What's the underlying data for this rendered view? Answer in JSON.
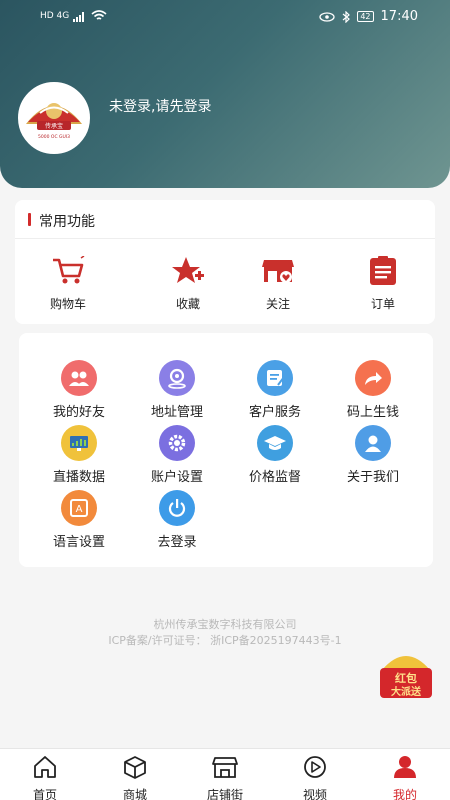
{
  "status_bar": {
    "network": "HD 4G",
    "battery": "42",
    "time": "17:40"
  },
  "header": {
    "login_prompt": "未登录,请先登录",
    "logo_text": "传承宝",
    "logo_subtext": "5000 OC GUI3"
  },
  "common_functions": {
    "title": "常用功能",
    "items": [
      {
        "label": "购物车",
        "icon": "shopping-cart-icon"
      },
      {
        "label": "收藏",
        "icon": "star-plus-icon"
      },
      {
        "label": "关注",
        "icon": "shop-heart-icon"
      },
      {
        "label": "订单",
        "icon": "order-list-icon"
      }
    ]
  },
  "services": {
    "items": [
      {
        "label": "我的好友",
        "icon": "friends-icon",
        "color": "#f06c6c"
      },
      {
        "label": "地址管理",
        "icon": "location-icon",
        "color": "#8a7fe6"
      },
      {
        "label": "客户服务",
        "icon": "service-icon",
        "color": "#4aa0e6"
      },
      {
        "label": "码上生钱",
        "icon": "share-icon",
        "color": "#f5714f"
      },
      {
        "label": "直播数据",
        "icon": "live-data-icon",
        "color": "#f0c23b"
      },
      {
        "label": "账户设置",
        "icon": "settings-icon",
        "color": "#7b6fe0"
      },
      {
        "label": "价格监督",
        "icon": "graduation-cap-icon",
        "color": "#3f9fe0"
      },
      {
        "label": "关于我们",
        "icon": "about-us-icon",
        "color": "#4f9de6"
      },
      {
        "label": "语言设置",
        "icon": "language-icon",
        "color": "#f28a3c"
      },
      {
        "label": "去登录",
        "icon": "power-icon",
        "color": "#3d9be8"
      }
    ]
  },
  "footer": {
    "company": "杭州传承宝数字科技有限公司",
    "icp": "ICP备案/许可证号： 浙ICP备2025197443号-1"
  },
  "red_packet": {
    "line1": "红包",
    "line2": "大派送"
  },
  "tabbar": {
    "items": [
      {
        "label": "首页",
        "icon": "home-icon",
        "active": false
      },
      {
        "label": "商城",
        "icon": "box-icon",
        "active": false
      },
      {
        "label": "店铺街",
        "icon": "storefront-icon",
        "active": false
      },
      {
        "label": "视频",
        "icon": "play-icon",
        "active": false
      },
      {
        "label": "我的",
        "icon": "profile-icon",
        "active": true
      }
    ]
  },
  "colors": {
    "accent": "#d4272b",
    "header_dark": "#2b5560",
    "header_light": "#6f9591"
  }
}
